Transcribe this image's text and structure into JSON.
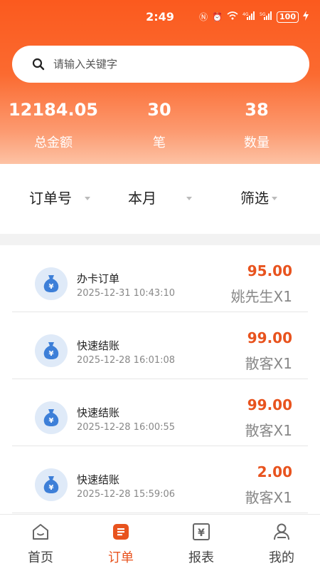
{
  "status_bar": {
    "time": "2:49",
    "battery": "100"
  },
  "search": {
    "placeholder": "请输入关键字"
  },
  "stats": [
    {
      "value": "12184.05",
      "label": "总金额"
    },
    {
      "value": "30",
      "label": "笔"
    },
    {
      "value": "38",
      "label": "数量"
    }
  ],
  "filters": [
    {
      "label": "订单号"
    },
    {
      "label": "本月"
    },
    {
      "label": "筛选"
    }
  ],
  "orders": [
    {
      "title": "办卡订单",
      "time": "2025-12-31 10:43:10",
      "amount": "95.00",
      "customer": "姚先生X1"
    },
    {
      "title": "快速结账",
      "time": "2025-12-28 16:01:08",
      "amount": "99.00",
      "customer": "散客X1"
    },
    {
      "title": "快速结账",
      "time": "2025-12-28 16:00:55",
      "amount": "99.00",
      "customer": "散客X1"
    },
    {
      "title": "快速结账",
      "time": "2025-12-28 15:59:06",
      "amount": "2.00",
      "customer": "散客X1"
    }
  ],
  "tabs": [
    {
      "label": "首页",
      "icon": "home-icon"
    },
    {
      "label": "订单",
      "icon": "order-icon",
      "active": true
    },
    {
      "label": "报表",
      "icon": "report-icon"
    },
    {
      "label": "我的",
      "icon": "user-icon"
    }
  ],
  "colors": {
    "accent": "#e8531e",
    "header": "#fb5a1e",
    "icon_bg": "#dfeaf8",
    "icon_fg": "#3d7fd8"
  }
}
